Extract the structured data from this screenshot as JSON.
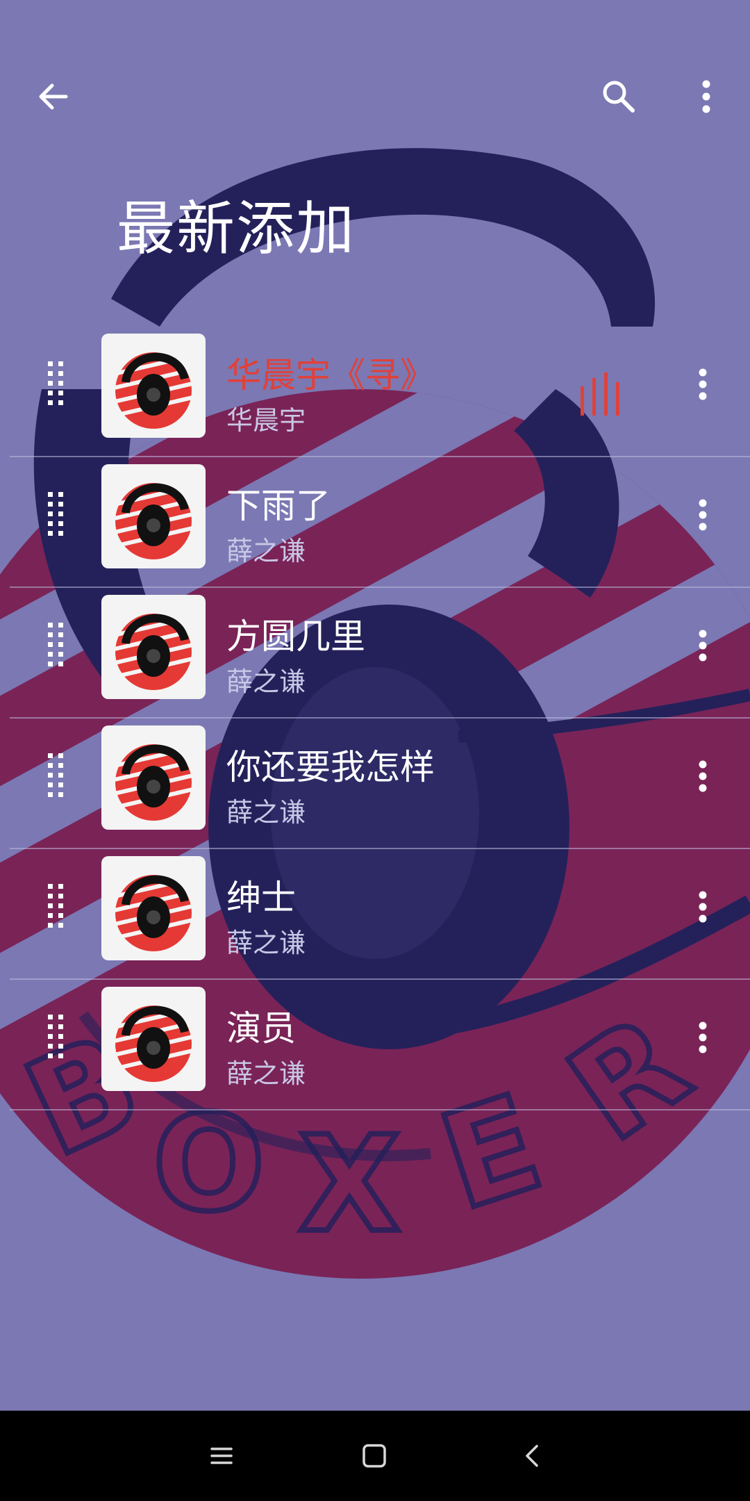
{
  "header": {
    "back_icon": "arrow-left-icon",
    "search_icon": "search-icon",
    "more_icon": "more-vertical-icon",
    "title": "最新添加"
  },
  "background": {
    "brand_text": "BOXER",
    "colors": {
      "base": "#7b78b3",
      "dark": "#24215a",
      "red": "#7a2357",
      "accent_red": "#e0413a"
    }
  },
  "songs": [
    {
      "title": "华晨宇《寻》",
      "artist": "华晨宇",
      "playing": true
    },
    {
      "title": "下雨了",
      "artist": "薛之谦",
      "playing": false
    },
    {
      "title": "方圆几里",
      "artist": "薛之谦",
      "playing": false
    },
    {
      "title": "你还要我怎样",
      "artist": "薛之谦",
      "playing": false
    },
    {
      "title": "绅士",
      "artist": "薛之谦",
      "playing": false
    },
    {
      "title": "演员",
      "artist": "薛之谦",
      "playing": false
    }
  ],
  "row_icons": {
    "drag": "drag-handle-icon",
    "more": "more-vertical-icon",
    "playing": "equalizer-icon",
    "art": "album-art"
  },
  "nav": {
    "menu": "menu-icon",
    "home": "home-square-icon",
    "back": "back-chevron-icon"
  }
}
